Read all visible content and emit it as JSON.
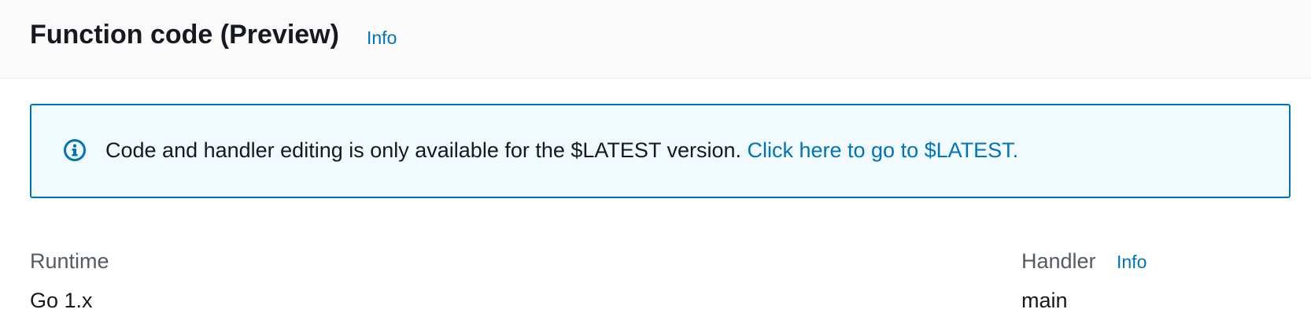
{
  "header": {
    "title": "Function code (Preview)",
    "info_label": "Info"
  },
  "alert": {
    "icon": "info-circle-icon",
    "message": "Code and handler editing is only available for the $LATEST version. ",
    "link_text": "Click here to go to $LATEST."
  },
  "runtime": {
    "label": "Runtime",
    "value": "Go 1.x"
  },
  "handler": {
    "label": "Handler",
    "info_label": "Info",
    "value": "main"
  },
  "colors": {
    "link": "#0073bb",
    "alert_border": "#0073bb",
    "alert_background": "#f1faff",
    "header_background": "#fafafa",
    "label_text": "#545b64",
    "body_text": "#16191f"
  }
}
